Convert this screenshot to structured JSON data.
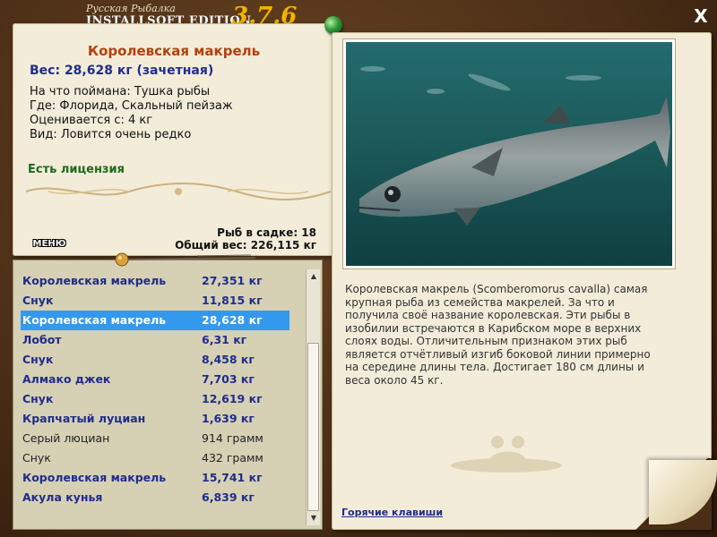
{
  "brand": {
    "subtitle": "Русская Рыбалка",
    "edition": "INSTALLSOFT EDITION",
    "version": "3.7.6"
  },
  "close_label": "X",
  "fish": {
    "name": "Королевская макрель",
    "weight": "Вес: 28,628 кг (зачетная)",
    "caught_on": "На что поймана: Тушка рыбы",
    "location": "Где: Флорида, Скальный пейзаж",
    "min_weight": "Оценивается с: 4 кг",
    "rarity": "Вид: Ловится очень редко",
    "license": "Есть лицензия"
  },
  "menu_label": "МЕНЮ",
  "stats": {
    "in_cage": "Рыб в садке: 18",
    "total_weight": "Общий вес: 226,115 кг"
  },
  "catch_list": [
    {
      "name": "Королевская макрель",
      "weight": "27,351 кг",
      "style": "bold"
    },
    {
      "name": "Снук",
      "weight": "11,815 кг",
      "style": "bold"
    },
    {
      "name": "Королевская макрель",
      "weight": "28,628 кг",
      "style": "bold",
      "selected": true
    },
    {
      "name": "Лобот",
      "weight": "6,31 кг",
      "style": "bold"
    },
    {
      "name": "Снук",
      "weight": "8,458 кг",
      "style": "bold"
    },
    {
      "name": "Алмако джек",
      "weight": "7,703 кг",
      "style": "bold"
    },
    {
      "name": "Снук",
      "weight": "12,619 кг",
      "style": "bold"
    },
    {
      "name": "Крапчатый луциан",
      "weight": "1,639 кг",
      "style": "bold"
    },
    {
      "name": "Серый люциан",
      "weight": "914 грамм",
      "style": "normal"
    },
    {
      "name": "Снук",
      "weight": "432 грамм",
      "style": "normal"
    },
    {
      "name": "Королевская макрель",
      "weight": "15,741 кг",
      "style": "bold"
    },
    {
      "name": "Акула кунья",
      "weight": "6,839 кг",
      "style": "bold"
    }
  ],
  "description": "Королевская макрель (Scomberomorus cavalla) самая крупная рыба из семейства макрелей. За что и получила своё название королевская. Эти рыбы в изобилии встречаются в Карибском море в верхних слоях воды. Отличительным признаком этих рыб является отчётливый изгиб боковой линии примерно на середине длины тела. Достигает 180 см длины и веса около 45 кг.",
  "hotkeys_label": "Горячие клавиши",
  "colors": {
    "title": "#b5410d",
    "accent_blue": "#1f2d8c",
    "license_green": "#1e6a1e",
    "selection": "#3399ee",
    "version_gold": "#f2b400"
  }
}
